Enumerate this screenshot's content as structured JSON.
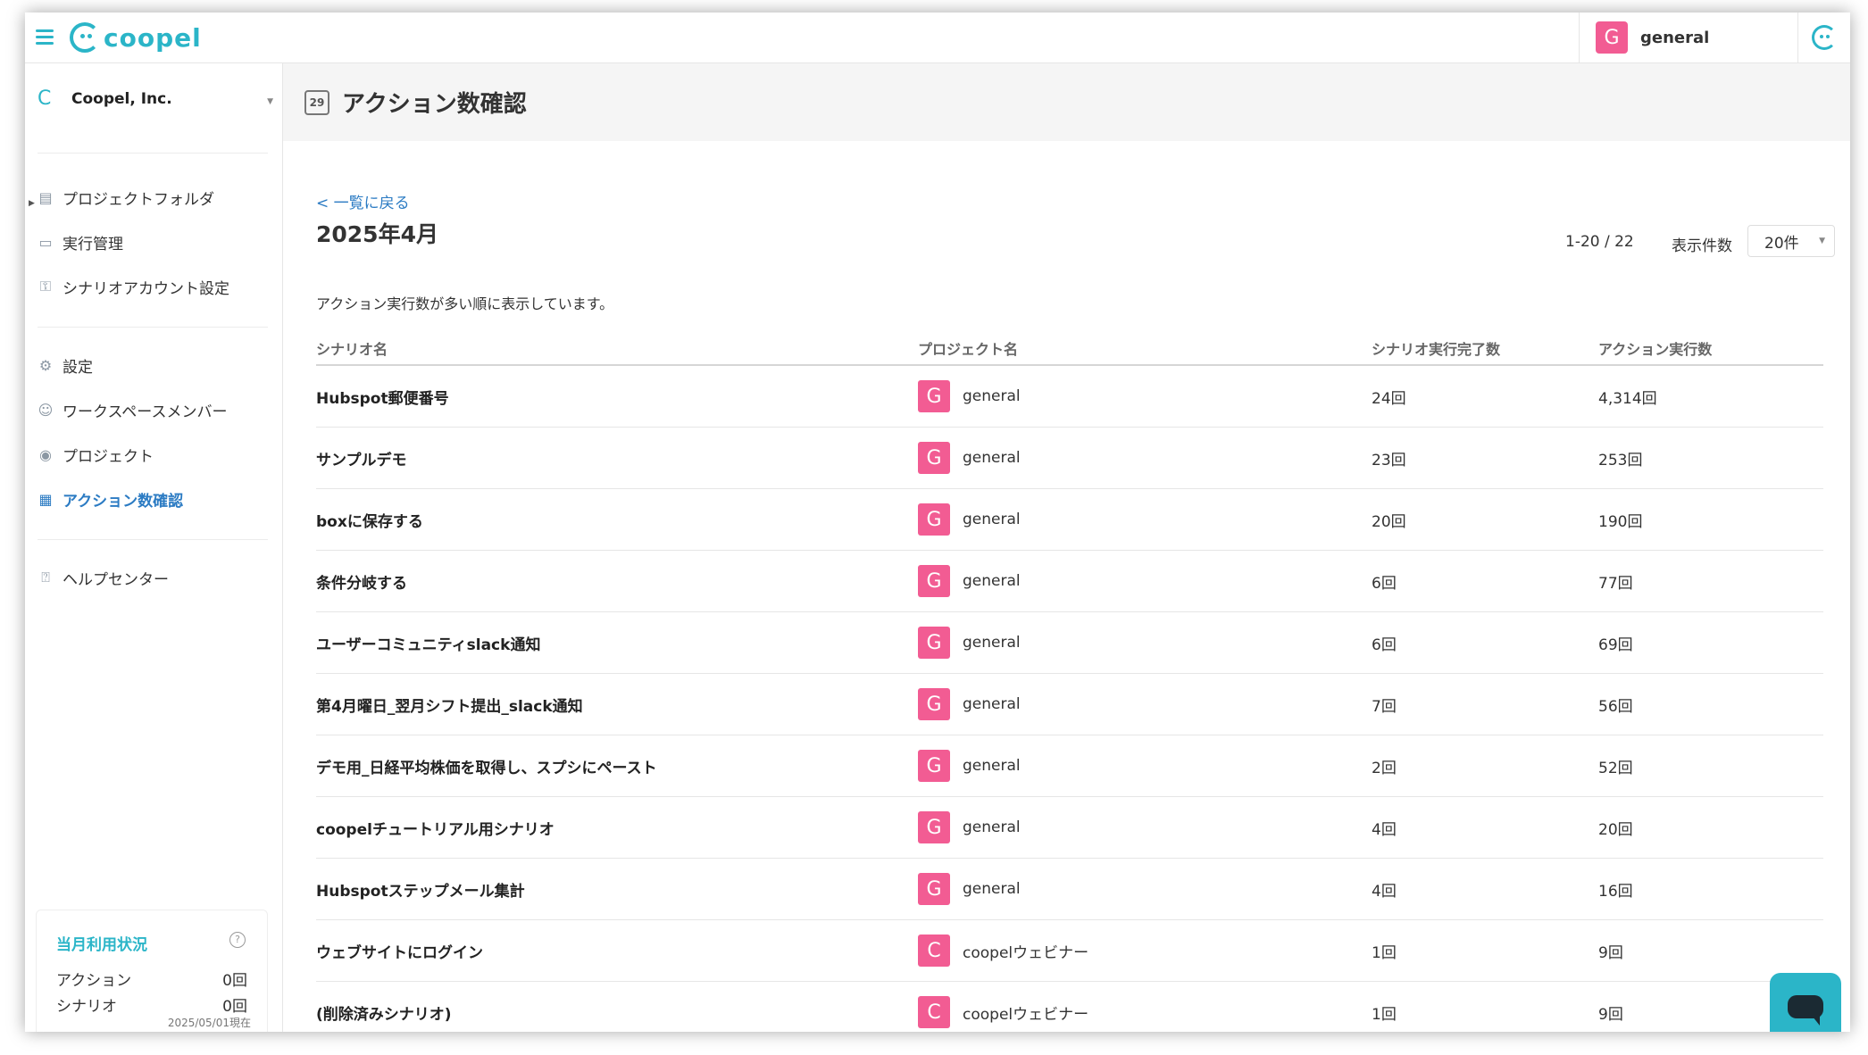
{
  "brand": {
    "logo_text": "coopel",
    "accent": "#2bb5c8",
    "badge_color": "#f25c93",
    "link_color": "#2b7bc3"
  },
  "topbar": {
    "workspace_badge": "G",
    "workspace_name": "general"
  },
  "sidebar": {
    "org_icon": "C",
    "org_name": "Coopel, Inc.",
    "group1": [
      {
        "label": "プロジェクトフォルダ",
        "icon": "folder-icon"
      },
      {
        "label": "実行管理",
        "icon": "window-icon"
      },
      {
        "label": "シナリオアカウント設定",
        "icon": "user-lock-icon"
      }
    ],
    "group2": [
      {
        "label": "設定",
        "icon": "gear-icon"
      },
      {
        "label": "ワークスペースメンバー",
        "icon": "users-icon"
      },
      {
        "label": "プロジェクト",
        "icon": "project-icon"
      },
      {
        "label": "アクション数確認",
        "icon": "calendar-icon",
        "active": true
      }
    ],
    "group3": [
      {
        "label": "ヘルプセンター",
        "icon": "help-icon"
      }
    ],
    "usage": {
      "title": "当月利用状況",
      "action_label": "アクション",
      "action_value": "0回",
      "scenario_label": "シナリオ",
      "scenario_value": "0回",
      "as_of": "2025/05/01現在"
    }
  },
  "page": {
    "title": "アクション数確認",
    "title_icon_text": "29",
    "back_link": "< 一覧に戻る",
    "month": "2025年4月",
    "pager": "1-20 / 22",
    "per_page_label": "表示件数",
    "per_page_value": "20件",
    "description": "アクション実行数が多い順に表示しています。"
  },
  "table": {
    "headers": [
      "シナリオ名",
      "プロジェクト名",
      "シナリオ実行完了数",
      "アクション実行数"
    ],
    "rows": [
      {
        "scenario": "Hubspot郵便番号",
        "badge": "G",
        "project": "general",
        "completed": "24回",
        "actions": "4,314回"
      },
      {
        "scenario": "サンプルデモ",
        "badge": "G",
        "project": "general",
        "completed": "23回",
        "actions": "253回"
      },
      {
        "scenario": "boxに保存する",
        "badge": "G",
        "project": "general",
        "completed": "20回",
        "actions": "190回"
      },
      {
        "scenario": "条件分岐する",
        "badge": "G",
        "project": "general",
        "completed": "6回",
        "actions": "77回"
      },
      {
        "scenario": "ユーザーコミュニティslack通知",
        "badge": "G",
        "project": "general",
        "completed": "6回",
        "actions": "69回"
      },
      {
        "scenario": "第4月曜日_翌月シフト提出_slack通知",
        "badge": "G",
        "project": "general",
        "completed": "7回",
        "actions": "56回"
      },
      {
        "scenario": "デモ用_日経平均株価を取得し、スプシにペースト",
        "badge": "G",
        "project": "general",
        "completed": "2回",
        "actions": "52回"
      },
      {
        "scenario": "coopelチュートリアル用シナリオ",
        "badge": "G",
        "project": "general",
        "completed": "4回",
        "actions": "20回"
      },
      {
        "scenario": "Hubspotステップメール集計",
        "badge": "G",
        "project": "general",
        "completed": "4回",
        "actions": "16回"
      },
      {
        "scenario": "ウェブサイトにログイン",
        "badge": "C",
        "project": "coopelウェビナー",
        "completed": "1回",
        "actions": "9回"
      },
      {
        "scenario": "(削除済みシナリオ)",
        "badge": "C",
        "project": "coopelウェビナー",
        "completed": "1回",
        "actions": "9回"
      }
    ]
  }
}
